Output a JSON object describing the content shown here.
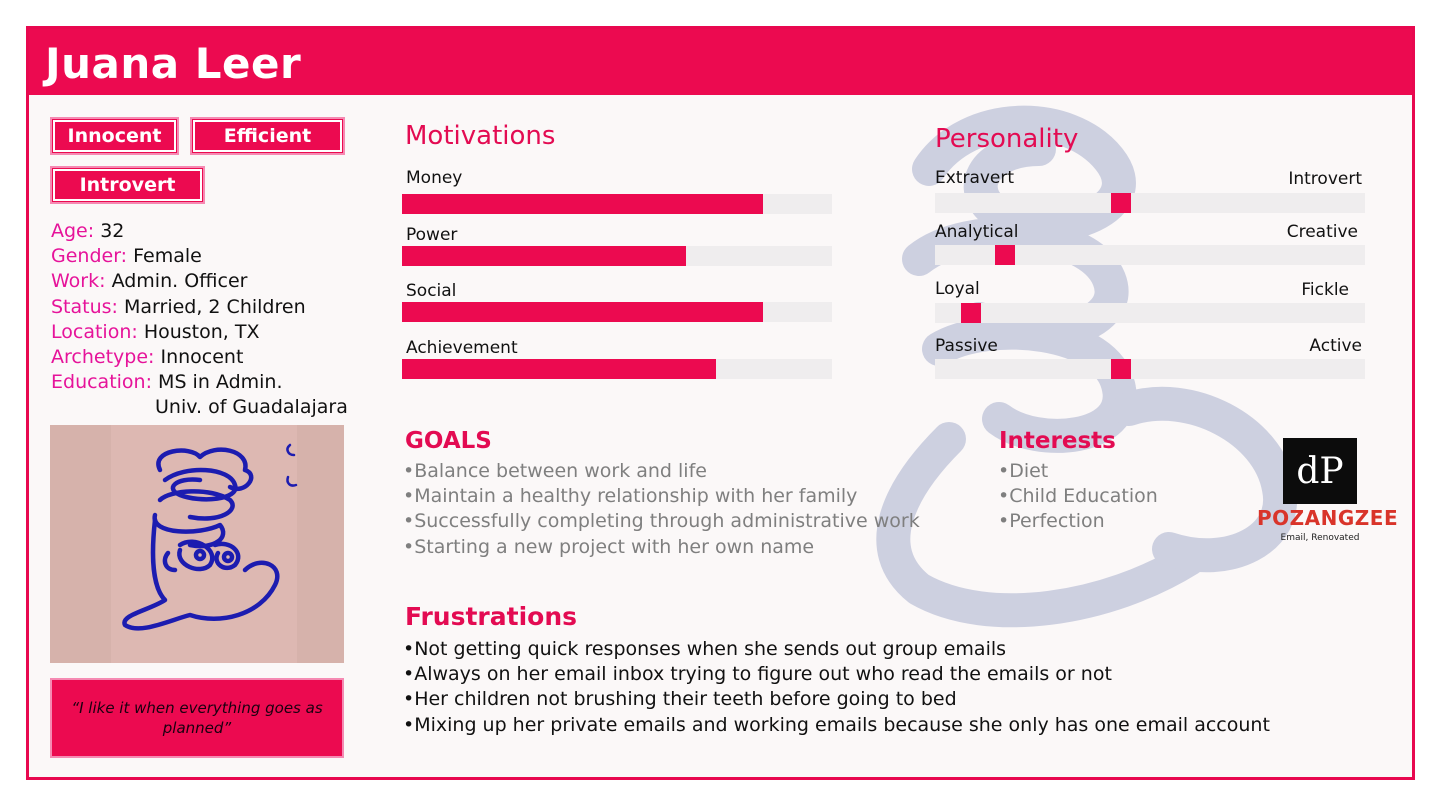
{
  "persona": {
    "name": "Juana Leer",
    "tags": [
      "Innocent",
      "Efficient",
      "Introvert"
    ],
    "details": [
      {
        "label": "Age:",
        "value": "32"
      },
      {
        "label": "Gender:",
        "value": "Female"
      },
      {
        "label": "Work:",
        "value": "Admin. Officer"
      },
      {
        "label": "Status:",
        "value": "Married, 2 Children"
      },
      {
        "label": "Location:",
        "value": "Houston, TX"
      },
      {
        "label": "Archetype:",
        "value": "Innocent"
      },
      {
        "label": "Education:",
        "value": "MS in Admin."
      }
    ],
    "education_line2": "Univ. of Guadalajara",
    "quote": "“I like it when everything goes as planned”"
  },
  "motivations": {
    "title": "Motivations",
    "items": [
      {
        "label": "Money",
        "value": 0.84
      },
      {
        "label": "Power",
        "value": 0.66
      },
      {
        "label": "Social",
        "value": 0.84
      },
      {
        "label": "Achievement",
        "value": 0.73
      }
    ]
  },
  "personality": {
    "title": "Personality",
    "scales": [
      {
        "left": "Extravert",
        "right": "Introvert",
        "value": 0.41
      },
      {
        "left": "Analytical",
        "right": "Creative",
        "value": 0.14
      },
      {
        "left": "Loyal",
        "right": "Fickle",
        "value": 0.06
      },
      {
        "left": "Passive",
        "right": "Active",
        "value": 0.41
      }
    ]
  },
  "goals": {
    "title": "GOALS",
    "items": [
      "•Balance between work and life",
      "•Maintain a healthy relationship with her family",
      "•Successfully completing through administrative work",
      "•Starting a new project with her own name"
    ]
  },
  "interests": {
    "title": "Interests",
    "items": [
      "•Diet",
      "•Child Education",
      "•Perfection"
    ]
  },
  "frustrations": {
    "title": "Frustrations",
    "items": [
      "•Not getting quick responses when she sends out group emails",
      "•Always on her email inbox trying to figure out who read the emails or not",
      "•Her children not brushing their teeth before going to bed",
      "•Mixing up her private emails and working emails because she only has one email account"
    ]
  },
  "logo": {
    "mark": "dP",
    "name": "POZANGZEE",
    "tagline": "Email, Renovated"
  },
  "colors": {
    "accent": "#ec0a50",
    "label_pink": "#e6139a",
    "track": "#efedee"
  }
}
